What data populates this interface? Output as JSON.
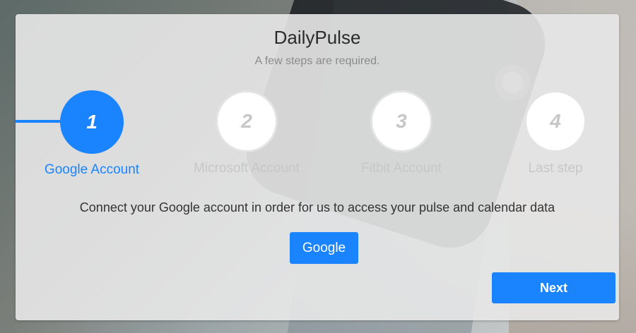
{
  "app": {
    "title": "DailyPulse",
    "subtitle": "A few steps are required."
  },
  "colors": {
    "accent": "#1a84ff",
    "inactive": "#c7c7c7",
    "card": "#e8e8e8"
  },
  "steps": [
    {
      "number": "1",
      "label": "Google Account",
      "state": "active"
    },
    {
      "number": "2",
      "label": "Microsoft Account",
      "state": "inactive"
    },
    {
      "number": "3",
      "label": "Fitbit Account",
      "state": "inactive"
    },
    {
      "number": "4",
      "label": "Last step",
      "state": "inactive"
    }
  ],
  "content": {
    "message": "Connect your Google account in order for us to access your pulse and calendar data",
    "google_button": "Google"
  },
  "footer": {
    "next_button": "Next"
  }
}
